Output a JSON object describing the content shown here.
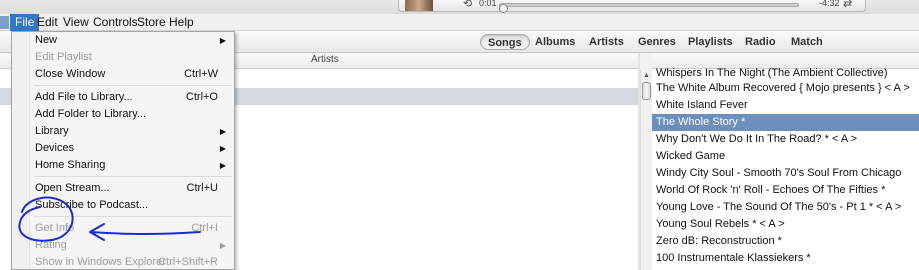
{
  "player": {
    "elapsed": "0:01",
    "remaining": "-4:32",
    "progress": 0.01,
    "repeat_icon": "repeat-icon",
    "shuffle_icon": "shuffle-icon"
  },
  "menubar": {
    "items": [
      "File",
      "Edit",
      "View",
      "Controls",
      "Store",
      "Help"
    ],
    "active": "File"
  },
  "tabs": {
    "items": [
      "Songs",
      "Albums",
      "Artists",
      "Genres",
      "Playlists",
      "Radio",
      "Match"
    ],
    "selected": "Songs"
  },
  "browser": {
    "column_header": "Artists"
  },
  "albums": {
    "items": [
      "Whispers In The Night (The Ambient Collective)",
      "The White Album Recovered { Mojo presents } < A >",
      "White Island Fever",
      "The Whole Story *",
      "Why Don't We Do It In The Road? * < A >",
      "Wicked Game",
      "Windy City Soul - Smooth 70's Soul From Chicago",
      "World Of Rock 'n' Roll - Echoes Of The Fifties *",
      "Young Love - The Sound Of The 50's - Pt 1 * < A >",
      "Young Soul Rebels * < A >",
      "Zero dB: Reconstruction *",
      "100 Instrumentale Klassiekers *"
    ],
    "selected_index": 3
  },
  "file_menu": {
    "items": [
      {
        "label": "New",
        "shortcut": "",
        "submenu": true,
        "disabled": false
      },
      {
        "label": "Edit Playlist",
        "shortcut": "",
        "submenu": false,
        "disabled": true
      },
      {
        "label": "Close Window",
        "shortcut": "Ctrl+W",
        "submenu": false,
        "disabled": false
      },
      {
        "label": "Add File to Library...",
        "shortcut": "Ctrl+O",
        "submenu": false,
        "disabled": false
      },
      {
        "label": "Add Folder to Library...",
        "shortcut": "",
        "submenu": false,
        "disabled": false
      },
      {
        "label": "Library",
        "shortcut": "",
        "submenu": true,
        "disabled": false
      },
      {
        "label": "Devices",
        "shortcut": "",
        "submenu": true,
        "disabled": false
      },
      {
        "label": "Home Sharing",
        "shortcut": "",
        "submenu": true,
        "disabled": false
      },
      {
        "label": "Open Stream...",
        "shortcut": "Ctrl+U",
        "submenu": false,
        "disabled": false
      },
      {
        "label": "Subscribe to Podcast...",
        "shortcut": "",
        "submenu": false,
        "disabled": false
      },
      {
        "label": "Get Info",
        "shortcut": "Ctrl+I",
        "submenu": false,
        "disabled": true
      },
      {
        "label": "Rating",
        "shortcut": "",
        "submenu": true,
        "disabled": true
      },
      {
        "label": "Show in Windows Explorer",
        "shortcut": "Ctrl+Shift+R",
        "submenu": false,
        "disabled": true
      }
    ]
  },
  "annotation": {
    "color": "#1a2bd6",
    "target": "Get Info"
  },
  "colors": {
    "menu_highlight": "#3375c6",
    "album_selected": "#6d8fc0",
    "left_selected": "#d5d9e1"
  }
}
